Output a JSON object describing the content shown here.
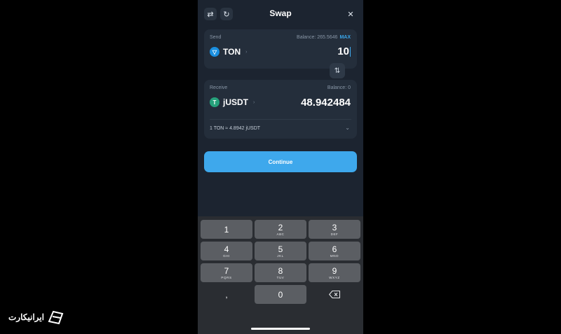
{
  "header": {
    "title": "Swap"
  },
  "send": {
    "label": "Send",
    "balance": "Balance: 265.5646",
    "max_label": "MAX",
    "token": "TON",
    "amount": "10"
  },
  "receive": {
    "label": "Receive",
    "balance": "Balance: 0",
    "token": "jUSDT",
    "amount": "48.942484",
    "rate": "1 TON ≈ 4.8942 jUSDT"
  },
  "continue_label": "Continue",
  "keypad": {
    "keys": [
      {
        "digit": "1",
        "letters": ""
      },
      {
        "digit": "2",
        "letters": "ABC"
      },
      {
        "digit": "3",
        "letters": "DEF"
      },
      {
        "digit": "4",
        "letters": "GHI"
      },
      {
        "digit": "5",
        "letters": "JKL"
      },
      {
        "digit": "6",
        "letters": "MNO"
      },
      {
        "digit": "7",
        "letters": "PQRS"
      },
      {
        "digit": "8",
        "letters": "TUV"
      },
      {
        "digit": "9",
        "letters": "WXYZ"
      }
    ],
    "decimal": ",",
    "zero": "0"
  },
  "watermark": {
    "text": "ایرانیکارت"
  },
  "colors": {
    "accent": "#3ea8ec",
    "ton": "#1a8fe0",
    "usdt": "#26a17b",
    "background": "#1c2430"
  },
  "icons": [
    "swap-settings-icon",
    "refresh-icon",
    "close-icon",
    "swap-direction-icon",
    "chevron-down-icon",
    "backspace-icon"
  ]
}
